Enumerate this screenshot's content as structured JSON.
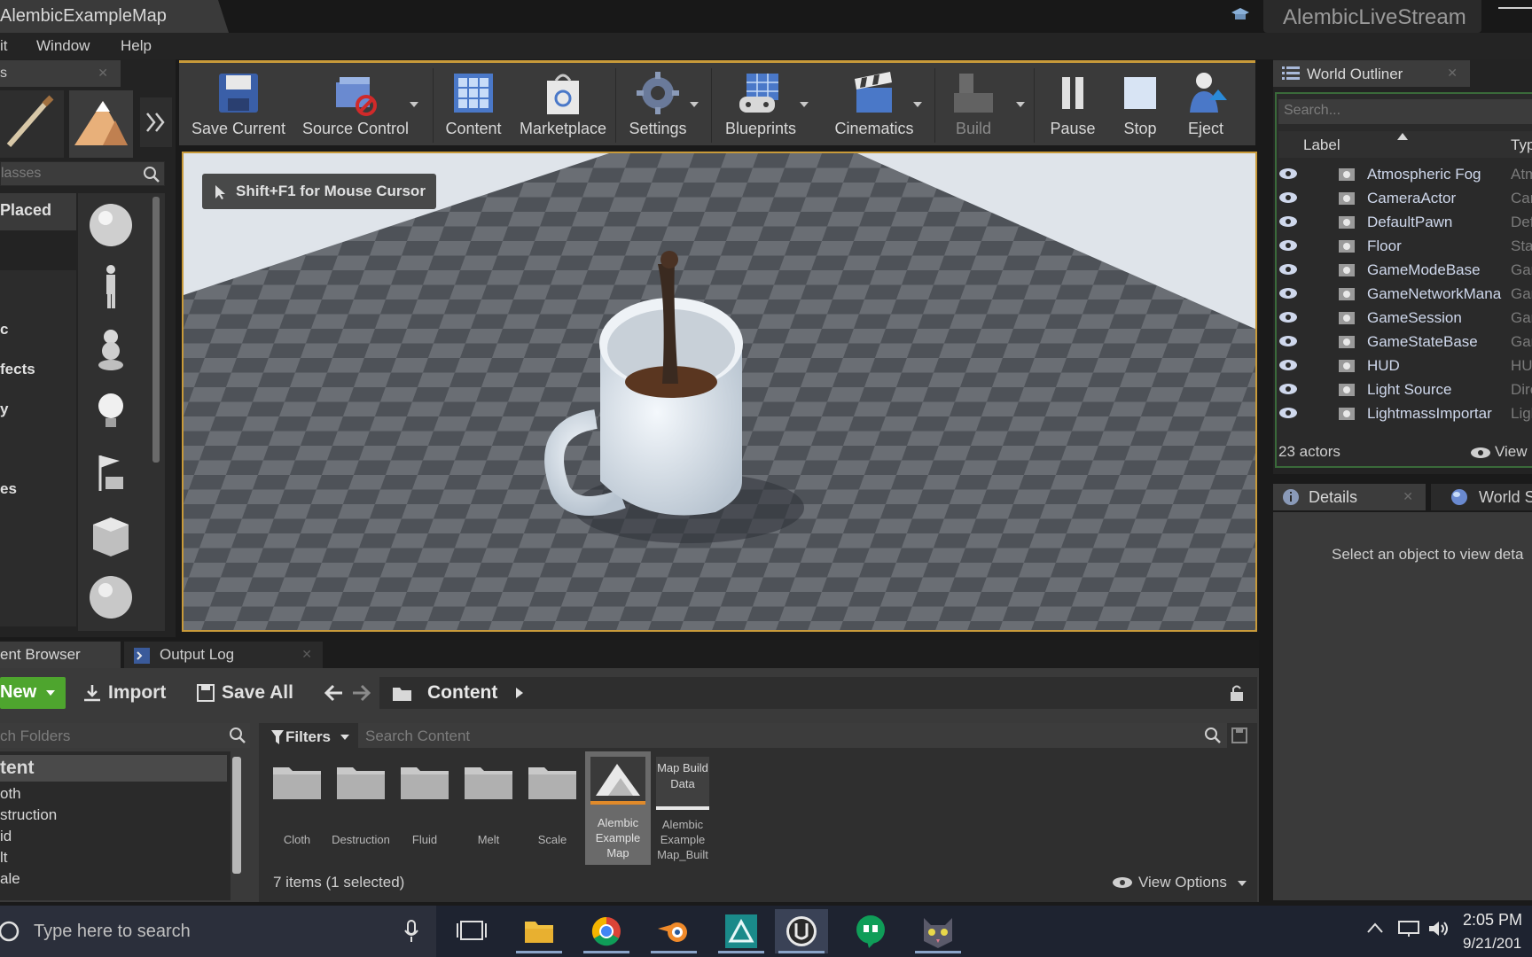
{
  "window": {
    "title": "AlembicExampleMap",
    "project": "AlembicLiveStream"
  },
  "menu": [
    "it",
    "Window",
    "Help"
  ],
  "modes": {
    "tab_label": "s",
    "search_placeholder": "lasses",
    "categories": [
      "Placed",
      "c",
      "fects",
      "y",
      "es"
    ]
  },
  "toolbar": {
    "items": [
      {
        "label": "Save Current",
        "icon": "save-icon"
      },
      {
        "label": "Source Control",
        "icon": "source-control-icon"
      },
      {
        "label": "Content",
        "icon": "content-icon"
      },
      {
        "label": "Marketplace",
        "icon": "marketplace-icon"
      },
      {
        "label": "Settings",
        "icon": "settings-icon"
      },
      {
        "label": "Blueprints",
        "icon": "blueprints-icon"
      },
      {
        "label": "Cinematics",
        "icon": "cinematics-icon"
      },
      {
        "label": "Build",
        "icon": "build-icon"
      },
      {
        "label": "Pause",
        "icon": "pause-icon"
      },
      {
        "label": "Stop",
        "icon": "stop-icon"
      },
      {
        "label": "Eject",
        "icon": "eject-icon"
      }
    ]
  },
  "viewport": {
    "hint": "Shift+F1 for Mouse Cursor"
  },
  "outliner": {
    "tab_label": "World Outliner",
    "search_placeholder": "Search...",
    "col_label": "Label",
    "col_type": "Typ",
    "rows": [
      {
        "name": "Atmospheric Fog",
        "type": "Atm"
      },
      {
        "name": "CameraActor",
        "type": "Can"
      },
      {
        "name": "DefaultPawn",
        "type": "Defa"
      },
      {
        "name": "Floor",
        "type": "Stat"
      },
      {
        "name": "GameModeBase",
        "type": "Gam"
      },
      {
        "name": "GameNetworkMana",
        "type": "Gam"
      },
      {
        "name": "GameSession",
        "type": "Gam"
      },
      {
        "name": "GameStateBase",
        "type": "Gam"
      },
      {
        "name": "HUD",
        "type": "HUD"
      },
      {
        "name": "Light Source",
        "type": "Dire"
      },
      {
        "name": "LightmassImportar",
        "type": "Ligh"
      }
    ],
    "actor_count": "23 actors",
    "view_label": "View"
  },
  "details": {
    "tab_label": "Details",
    "world_tab_label": "World S",
    "empty_text": "Select an object to view deta"
  },
  "content_browser": {
    "tab_label": "ent Browser",
    "output_log_label": "Output Log",
    "new_label": "New",
    "import_label": "Import",
    "save_all_label": "Save All",
    "path": "Content",
    "folders_search_placeholder": "ch Folders",
    "filters_label": "Filters",
    "search_placeholder": "Search Content",
    "tree": [
      "tent",
      "oth",
      "struction",
      "id",
      "lt",
      "ale"
    ],
    "folders": [
      "Cloth",
      "Destruction",
      "Fluid",
      "Melt",
      "Scale"
    ],
    "asset1": "Alembic Example Map",
    "asset2": "Alembic Example Map_Built",
    "asset2_thumb": "Map Build Data",
    "item_count": "7 items (1 selected)",
    "view_options": "View Options"
  },
  "taskbar": {
    "search_placeholder": "Type here to search",
    "time": "2:05 PM",
    "date": "9/21/201"
  }
}
